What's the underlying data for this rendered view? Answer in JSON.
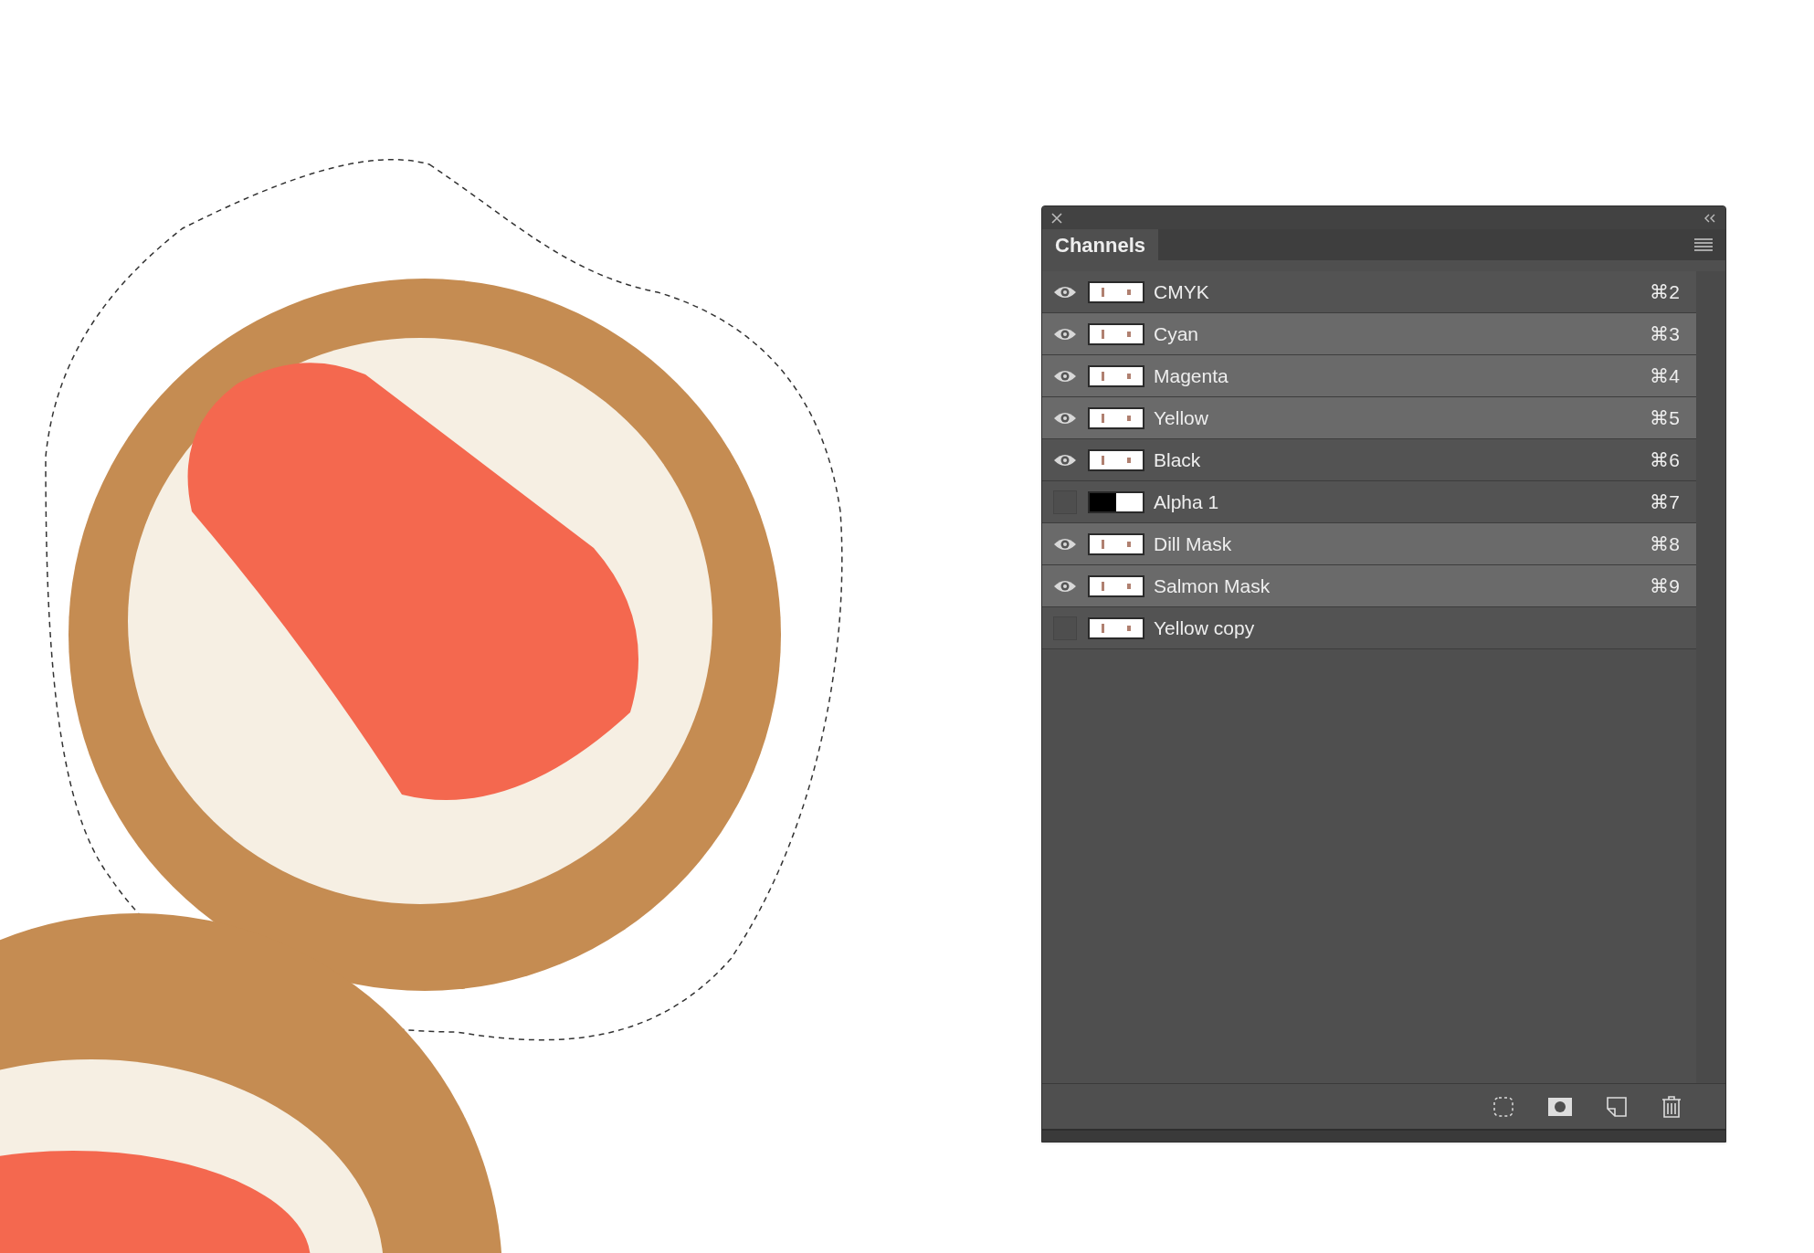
{
  "panel": {
    "tab": "Channels"
  },
  "channels": [
    {
      "name": "CMYK",
      "shortcut": "⌘2",
      "visible": true,
      "selected": false,
      "kind": "color"
    },
    {
      "name": "Cyan",
      "shortcut": "⌘3",
      "visible": true,
      "selected": true,
      "kind": "color"
    },
    {
      "name": "Magenta",
      "shortcut": "⌘4",
      "visible": true,
      "selected": true,
      "kind": "color"
    },
    {
      "name": "Yellow",
      "shortcut": "⌘5",
      "visible": true,
      "selected": true,
      "kind": "color"
    },
    {
      "name": "Black",
      "shortcut": "⌘6",
      "visible": true,
      "selected": false,
      "kind": "color"
    },
    {
      "name": "Alpha 1",
      "shortcut": "⌘7",
      "visible": false,
      "selected": false,
      "kind": "alpha"
    },
    {
      "name": "Dill Mask",
      "shortcut": "⌘8",
      "visible": true,
      "selected": true,
      "kind": "color"
    },
    {
      "name": "Salmon Mask",
      "shortcut": "⌘9",
      "visible": true,
      "selected": true,
      "kind": "color"
    },
    {
      "name": "Yellow copy",
      "visible": false,
      "selected": false,
      "kind": "color"
    }
  ]
}
